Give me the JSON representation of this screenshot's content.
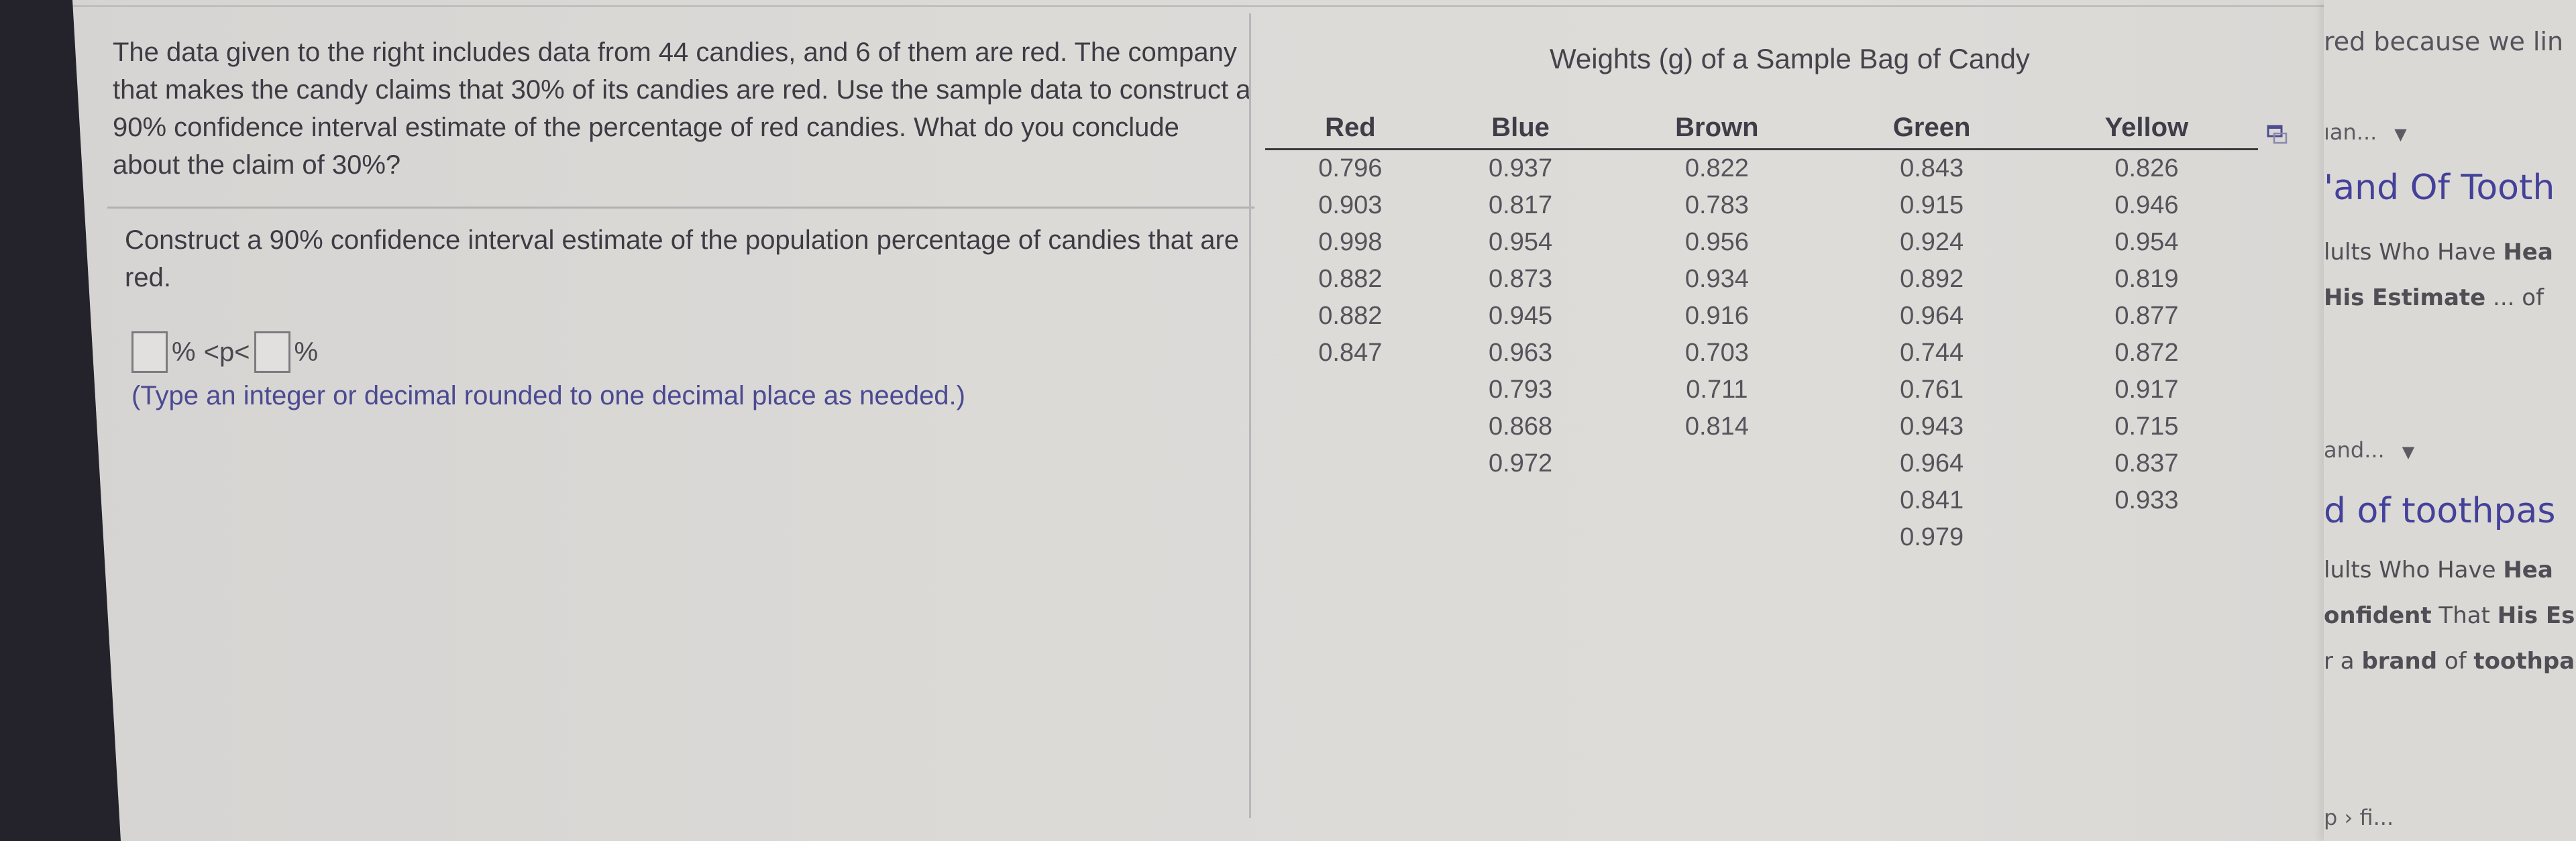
{
  "question": {
    "text": "The data given to the right includes data from 44 candies, and 6 of them are red. The company that makes the candy claims that 30% of its candies are red. Use the sample data to construct a 90% confidence interval estimate of the percentage of red candies. What do you conclude about the claim of 30%?",
    "prompt": "Construct a 90% confidence interval estimate of the population percentage of candies that are red.",
    "answer": {
      "lower_value": "",
      "upper_value": "",
      "percent_sign": "%",
      "middle": "<p<"
    },
    "hint": "(Type an integer or decimal rounded to one decimal place as needed.)"
  },
  "table": {
    "title": "Weights (g) of a Sample Bag of Candy",
    "columns": [
      "Red",
      "Blue",
      "Brown",
      "Green",
      "Yellow"
    ],
    "data": {
      "Red": [
        "0.796",
        "0.903",
        "0.998",
        "0.882",
        "0.882",
        "0.847"
      ],
      "Blue": [
        "0.937",
        "0.817",
        "0.954",
        "0.873",
        "0.945",
        "0.963",
        "0.793",
        "0.868",
        "0.972"
      ],
      "Brown": [
        "0.822",
        "0.783",
        "0.956",
        "0.934",
        "0.916",
        "0.703",
        "0.711",
        "0.814"
      ],
      "Green": [
        "0.843",
        "0.915",
        "0.924",
        "0.892",
        "0.964",
        "0.744",
        "0.761",
        "0.943",
        "0.964",
        "0.841",
        "0.979"
      ],
      "Yellow": [
        "0.826",
        "0.946",
        "0.954",
        "0.819",
        "0.877",
        "0.872",
        "0.917",
        "0.715",
        "0.837",
        "0.933"
      ]
    },
    "popout_icon": "popout-window-icon"
  },
  "side_panel": {
    "line1": "red because we lin",
    "dropdown1": "ıan...",
    "link1": "'and Of Tooth",
    "line2a": "lults Who Have ",
    "line2b": "Hea",
    "line3a": "His Estimate",
    "line3b": " ... of",
    "dropdown2": "and...",
    "link2": "d of toothpas",
    "line4a": "lults Who Have ",
    "line4b": "Hea",
    "line5a": "onfident",
    "line5b": " That ",
    "line5c": "His Es",
    "line6a": "r a ",
    "line6b": "brand",
    "line6c": " of ",
    "line6d": "toothpa",
    "breadcrumb": "p › fi..."
  }
}
